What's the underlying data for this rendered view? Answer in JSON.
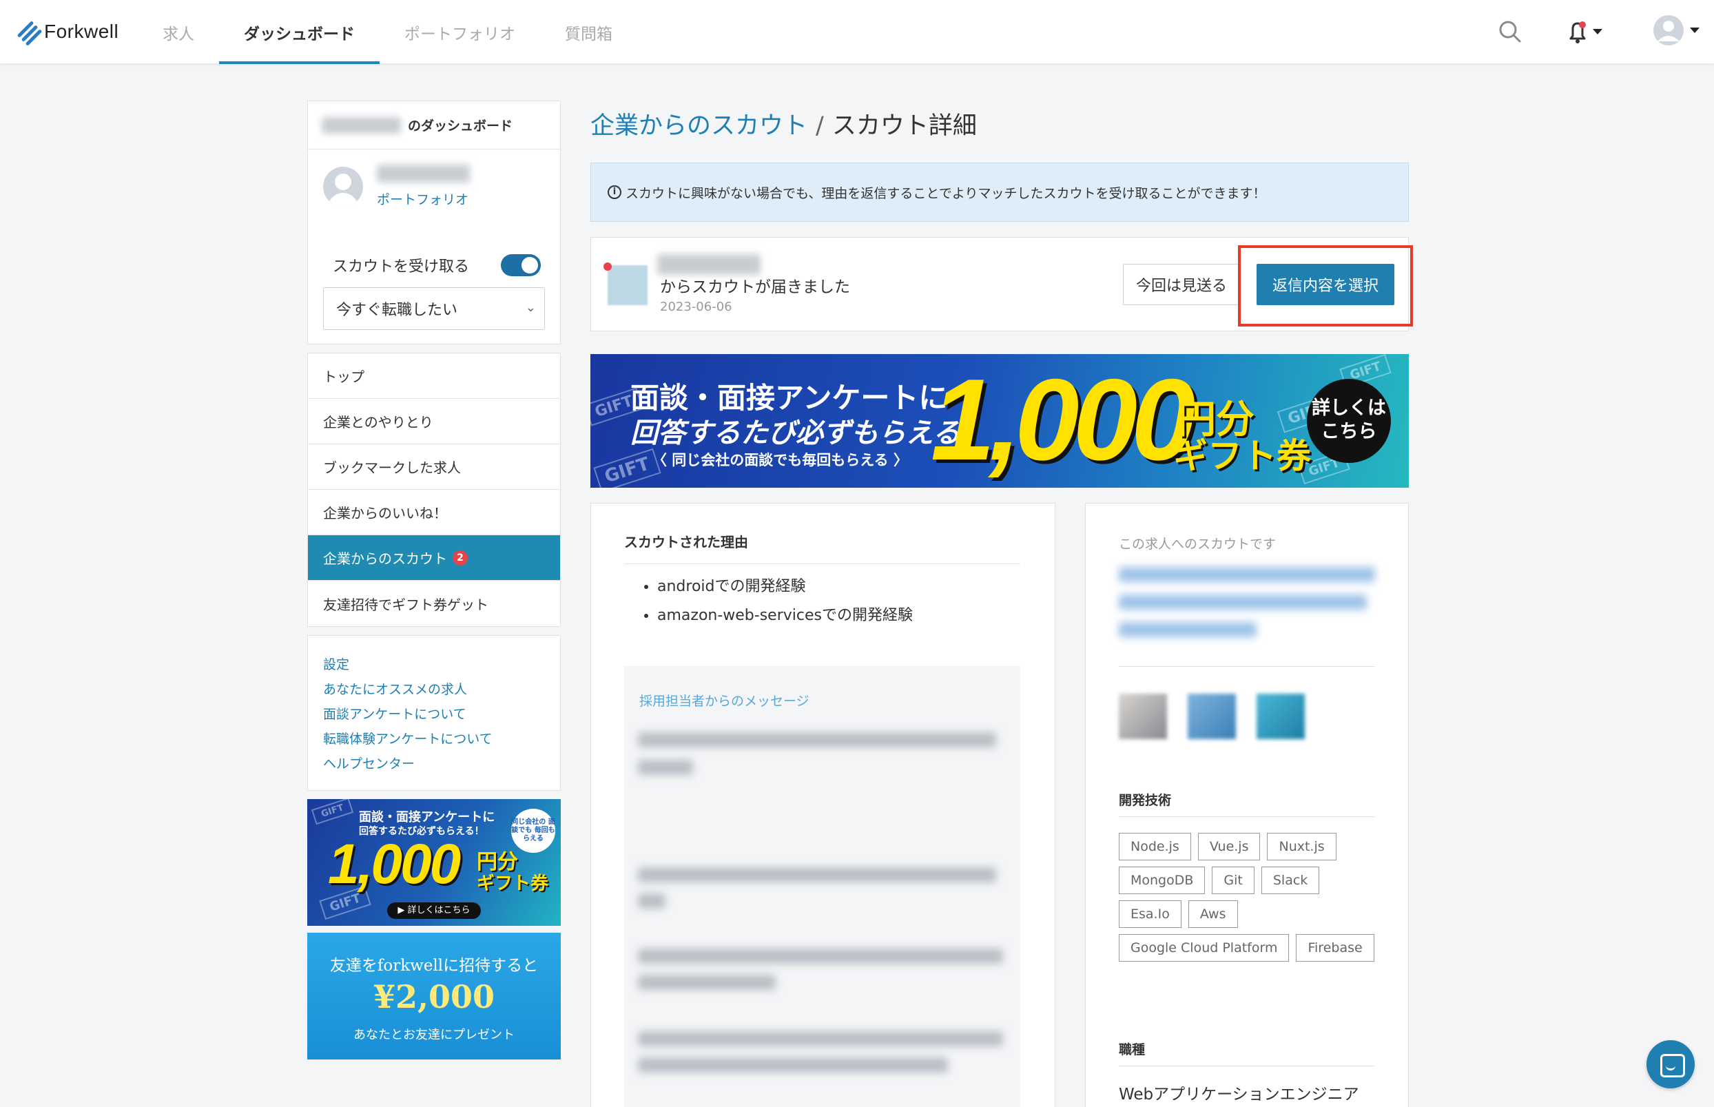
{
  "header": {
    "logo_text": "Forkwell",
    "nav": [
      {
        "label": "求人"
      },
      {
        "label": "ダッシュボード",
        "active": true
      },
      {
        "label": "ポートフォリオ"
      },
      {
        "label": "質問箱"
      }
    ],
    "icons": [
      "search-icon",
      "bell-icon",
      "avatar-icon"
    ]
  },
  "sidebar": {
    "dashboard_title_suffix": "のダッシュボード",
    "portfolio_link": "ポートフォリオ",
    "scout_toggle_label": "スカウトを受け取る",
    "scout_toggle_on": true,
    "job_status_select": "今すぐ転職したい",
    "menu": [
      {
        "label": "トップ"
      },
      {
        "label": "企業とのやりとり"
      },
      {
        "label": "ブックマークした求人"
      },
      {
        "label": "企業からのいいね！"
      },
      {
        "label": "企業からのスカウト",
        "badge": "2",
        "active": true
      },
      {
        "label": "友達招待でギフト券ゲット"
      }
    ],
    "links": [
      "設定",
      "あなたにオススメの求人",
      "面談アンケートについて",
      "転職体験アンケートについて",
      "ヘルプセンター"
    ],
    "gift_banner": {
      "line1": "面談・面接アンケートに",
      "line2": "回答するたび必ずもらえる！",
      "amount": "1,000",
      "yen": "円分",
      "gift": "ギフト券",
      "circle": "同じ会社の 面談でも 毎回もらえる",
      "cta": "▶ 詳しくはこちら"
    },
    "friend_banner": {
      "line1": "友達をforkwellに招待すると",
      "amount": "¥2,000",
      "line2": "あなたとお友達にプレゼント"
    }
  },
  "main": {
    "breadcrumb": {
      "parent": "企業からのスカウト",
      "separator": "/",
      "current": "スカウト詳細"
    },
    "info_message": "スカウトに興味がない場合でも、理由を返信することでよりマッチしたスカウトを受け取ることができます！",
    "scout": {
      "message": "からスカウトが届きました",
      "date": "2023-06-06",
      "skip_button": "今回は見送る",
      "reply_button": "返信内容を選択"
    },
    "banner": {
      "line1": "面談・面接アンケートに",
      "line2": "回答するたび必ずもらえる！",
      "line3": "〈 同じ会社の面談でも毎回もらえる 〉",
      "amount": "1,000",
      "yen": "円分",
      "gift": "ギフト券",
      "cta_line1": "詳しくは",
      "cta_line2": "こちら",
      "tag": "GIFT"
    },
    "reason": {
      "title": "スカウトされた理由",
      "items": [
        "androidでの開発経験",
        "amazon-web-servicesでの開発経験"
      ],
      "message_title": "採用担当者からのメッセージ"
    },
    "job": {
      "subtitle": "この求人へのスカウトです",
      "tech_title": "開発技術",
      "tags": [
        "Node.js",
        "Vue.js",
        "Nuxt.js",
        "MongoDB",
        "Git",
        "Slack",
        "Esa.Io",
        "Aws",
        "Google Cloud Platform",
        "Firebase"
      ],
      "role_title": "職種",
      "role": "Webアプリケーションエンジニア"
    }
  },
  "colors": {
    "accent": "#1f7fb0",
    "link": "#1e7fb5",
    "highlight": "#e53b2a",
    "badge": "#e8424b",
    "info_bg": "#deedf8"
  }
}
